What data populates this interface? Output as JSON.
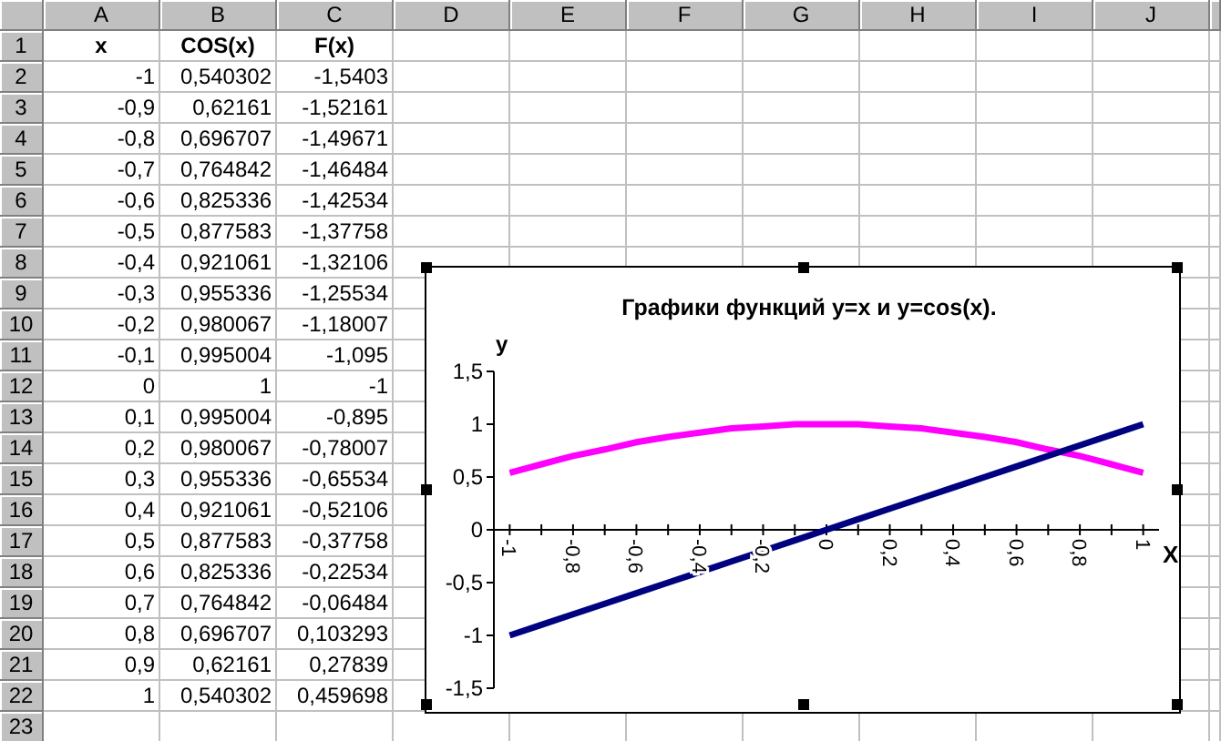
{
  "sheet": {
    "columns": [
      "A",
      "B",
      "C",
      "D",
      "E",
      "F",
      "G",
      "H",
      "I",
      "J"
    ],
    "rows": [
      {
        "number": "1",
        "kind": "header",
        "cells": [
          "x",
          "COS(x)",
          "F(x)"
        ]
      },
      {
        "number": "2",
        "kind": "data",
        "cells": [
          "-1",
          "0,540302",
          "-1,5403"
        ]
      },
      {
        "number": "3",
        "kind": "data",
        "cells": [
          "-0,9",
          "0,62161",
          "-1,52161"
        ]
      },
      {
        "number": "4",
        "kind": "data",
        "cells": [
          "-0,8",
          "0,696707",
          "-1,49671"
        ]
      },
      {
        "number": "5",
        "kind": "data",
        "cells": [
          "-0,7",
          "0,764842",
          "-1,46484"
        ]
      },
      {
        "number": "6",
        "kind": "data",
        "cells": [
          "-0,6",
          "0,825336",
          "-1,42534"
        ]
      },
      {
        "number": "7",
        "kind": "data",
        "cells": [
          "-0,5",
          "0,877583",
          "-1,37758"
        ]
      },
      {
        "number": "8",
        "kind": "data",
        "cells": [
          "-0,4",
          "0,921061",
          "-1,32106"
        ]
      },
      {
        "number": "9",
        "kind": "data",
        "cells": [
          "-0,3",
          "0,955336",
          "-1,25534"
        ]
      },
      {
        "number": "10",
        "kind": "data",
        "cells": [
          "-0,2",
          "0,980067",
          "-1,18007"
        ]
      },
      {
        "number": "11",
        "kind": "data",
        "cells": [
          "-0,1",
          "0,995004",
          "-1,095"
        ]
      },
      {
        "number": "12",
        "kind": "data",
        "cells": [
          "0",
          "1",
          "-1"
        ]
      },
      {
        "number": "13",
        "kind": "data",
        "cells": [
          "0,1",
          "0,995004",
          "-0,895"
        ]
      },
      {
        "number": "14",
        "kind": "data",
        "cells": [
          "0,2",
          "0,980067",
          "-0,78007"
        ]
      },
      {
        "number": "15",
        "kind": "data",
        "cells": [
          "0,3",
          "0,955336",
          "-0,65534"
        ]
      },
      {
        "number": "16",
        "kind": "data",
        "cells": [
          "0,4",
          "0,921061",
          "-0,52106"
        ]
      },
      {
        "number": "17",
        "kind": "data",
        "cells": [
          "0,5",
          "0,877583",
          "-0,37758"
        ]
      },
      {
        "number": "18",
        "kind": "data",
        "cells": [
          "0,6",
          "0,825336",
          "-0,22534"
        ]
      },
      {
        "number": "19",
        "kind": "data",
        "cells": [
          "0,7",
          "0,764842",
          "-0,06484"
        ]
      },
      {
        "number": "20",
        "kind": "data",
        "cells": [
          "0,8",
          "0,696707",
          "0,103293"
        ]
      },
      {
        "number": "21",
        "kind": "data",
        "cells": [
          "0,9",
          "0,62161",
          "0,27839"
        ]
      },
      {
        "number": "22",
        "kind": "data",
        "cells": [
          "1",
          "0,540302",
          "0,459698"
        ]
      },
      {
        "number": "23",
        "kind": "data",
        "cells": []
      }
    ]
  },
  "chart": {
    "chart_data": {
      "type": "line",
      "title": "Графики функций y=x и y=cos(x).",
      "xlabel": "X",
      "ylabel": "y",
      "x": [
        -1,
        -0.9,
        -0.8,
        -0.7,
        -0.6,
        -0.5,
        -0.4,
        -0.3,
        -0.2,
        -0.1,
        0,
        0.1,
        0.2,
        0.3,
        0.4,
        0.5,
        0.6,
        0.7,
        0.8,
        0.9,
        1
      ],
      "series": [
        {
          "color": "#ff00ff",
          "values": [
            0.54,
            0.62,
            0.7,
            0.76,
            0.83,
            0.88,
            0.92,
            0.96,
            0.98,
            1,
            1,
            1,
            0.98,
            0.96,
            0.92,
            0.88,
            0.83,
            0.76,
            0.7,
            0.62,
            0.54
          ]
        },
        {
          "color": "#000080",
          "values": [
            -1,
            -0.9,
            -0.8,
            -0.7,
            -0.6,
            -0.5,
            -0.4,
            -0.3,
            -0.2,
            -0.1,
            0,
            0.1,
            0.2,
            0.3,
            0.4,
            0.5,
            0.6,
            0.7,
            0.8,
            0.9,
            1
          ]
        }
      ],
      "xlim": [
        -1.05,
        1.05
      ],
      "ylim": [
        -1.5,
        1.5
      ],
      "yticks": [
        {
          "value": -1.5,
          "label": "-1,5"
        },
        {
          "value": -1,
          "label": "-1"
        },
        {
          "value": -0.5,
          "label": "-0,5"
        },
        {
          "value": 0,
          "label": "0"
        },
        {
          "value": 0.5,
          "label": "0,5"
        },
        {
          "value": 1,
          "label": "1"
        },
        {
          "value": 1.5,
          "label": "1,5"
        }
      ],
      "xticks": [
        {
          "value": -1,
          "label": "-1"
        },
        {
          "value": -0.8,
          "label": "-0,8"
        },
        {
          "value": -0.6,
          "label": "-0,6"
        },
        {
          "value": -0.4,
          "label": "-0,4"
        },
        {
          "value": -0.2,
          "label": "-0,2"
        },
        {
          "value": 0,
          "label": "0"
        },
        {
          "value": 0.2,
          "label": "0,2"
        },
        {
          "value": 0.4,
          "label": "0,4"
        },
        {
          "value": 0.6,
          "label": "0,6"
        },
        {
          "value": 0.8,
          "label": "0,8"
        },
        {
          "value": 1,
          "label": "1"
        }
      ]
    }
  }
}
